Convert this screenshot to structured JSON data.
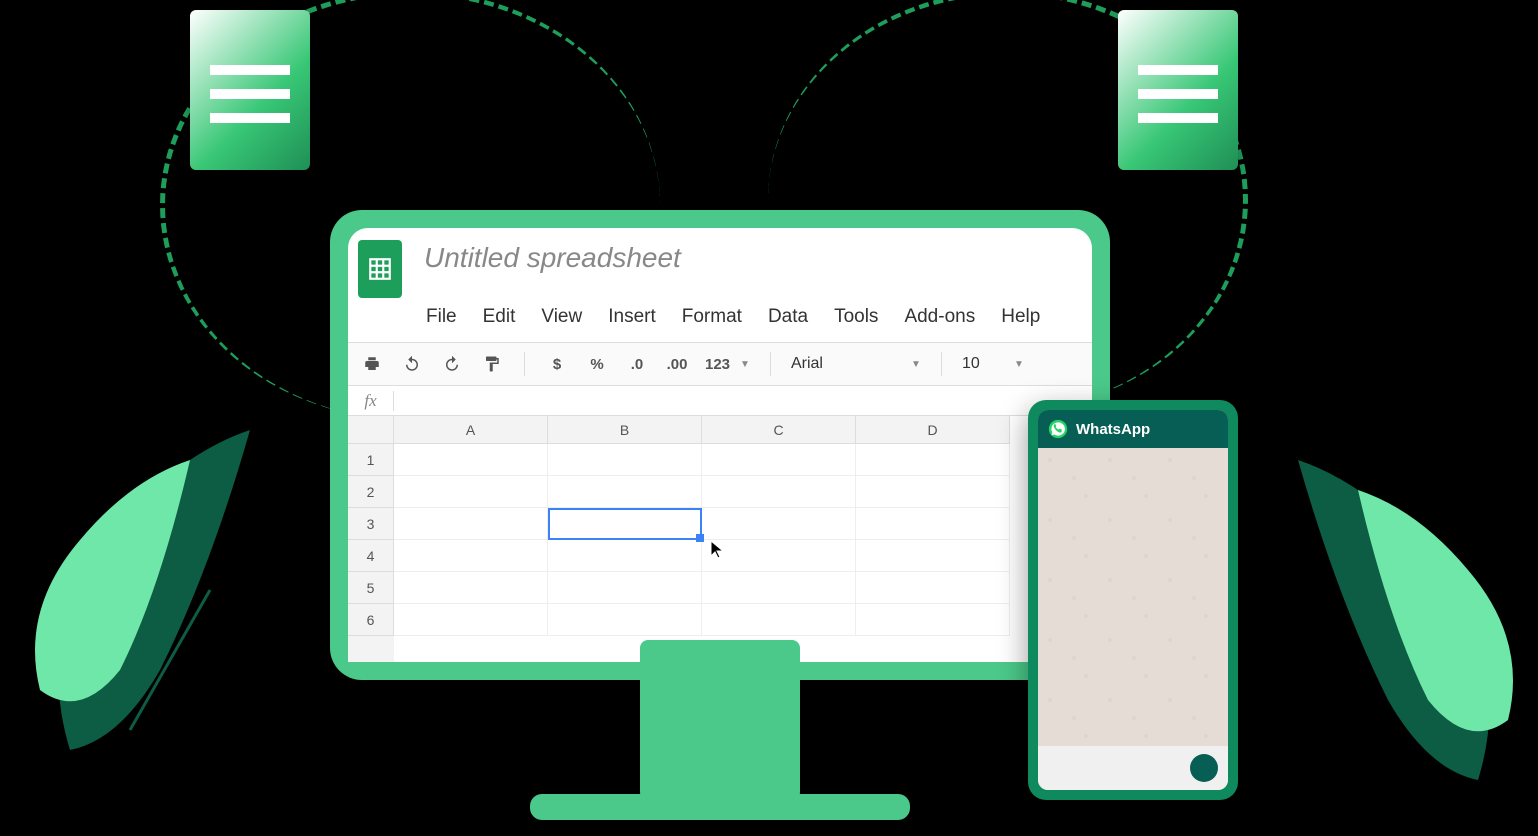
{
  "sheets": {
    "title": "Untitled spreadsheet",
    "menu": [
      "File",
      "Edit",
      "View",
      "Insert",
      "Format",
      "Data",
      "Tools",
      "Add-ons",
      "Help"
    ],
    "toolbar": {
      "currency": "$",
      "percent": "%",
      "dec_dec": ".0",
      "inc_dec": ".00",
      "format_num": "123",
      "font": "Arial",
      "font_size": "10"
    },
    "fx_label": "fx",
    "columns": [
      "A",
      "B",
      "C",
      "D"
    ],
    "rows": [
      "1",
      "2",
      "3",
      "4",
      "5",
      "6"
    ],
    "selected_cell": "B3"
  },
  "whatsapp": {
    "title": "WhatsApp"
  }
}
